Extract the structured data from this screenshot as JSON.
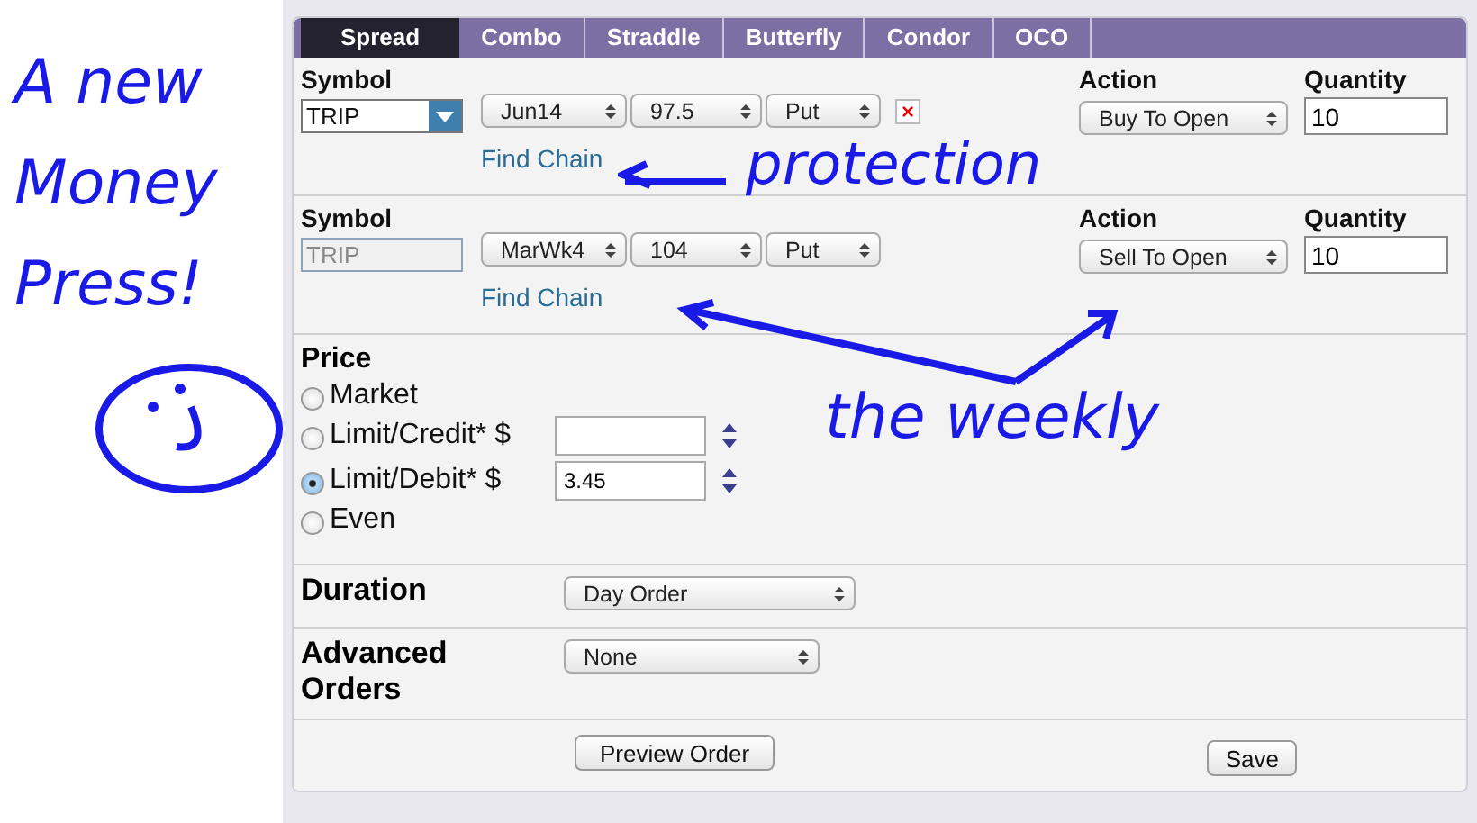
{
  "tabs": [
    {
      "label": "Spread",
      "selected": true
    },
    {
      "label": "Combo",
      "selected": false
    },
    {
      "label": "Straddle",
      "selected": false
    },
    {
      "label": "Butterfly",
      "selected": false
    },
    {
      "label": "Condor",
      "selected": false
    },
    {
      "label": "OCO",
      "selected": false
    }
  ],
  "legs": [
    {
      "symbol_label": "Symbol",
      "symbol": "TRIP",
      "symbol_disabled": false,
      "expiry": "Jun14",
      "strike": "97.5",
      "type": "Put",
      "removable": true,
      "remove_icon": "×",
      "link": "Find Chain",
      "action_label": "Action",
      "action": "Buy To Open",
      "quantity_label": "Quantity",
      "quantity": "10"
    },
    {
      "symbol_label": "Symbol",
      "symbol": "TRIP",
      "symbol_disabled": true,
      "expiry": "MarWk4",
      "strike": "104",
      "type": "Put",
      "removable": false,
      "link": "Find Chain",
      "action_label": "Action",
      "action": "Sell To Open",
      "quantity_label": "Quantity",
      "quantity": "10"
    }
  ],
  "price": {
    "title": "Price",
    "options": [
      {
        "label": "Market",
        "selected": false,
        "kind": "plain"
      },
      {
        "label": "Limit/Credit* $",
        "selected": false,
        "kind": "input"
      },
      {
        "label": "Limit/Debit* $",
        "selected": true,
        "kind": "input",
        "value": "3.45"
      },
      {
        "label": "Even",
        "selected": false,
        "kind": "plain"
      }
    ]
  },
  "duration": {
    "label": "Duration",
    "value": "Day Order"
  },
  "advanced_orders": {
    "label": "Advanced Orders",
    "value": "None"
  },
  "buttons": {
    "preview": "Preview Order",
    "save": "Save"
  },
  "annotations": {
    "side_note": "A new Money Press!",
    "protection_note": "protection",
    "weekly_note": "the weekly"
  }
}
